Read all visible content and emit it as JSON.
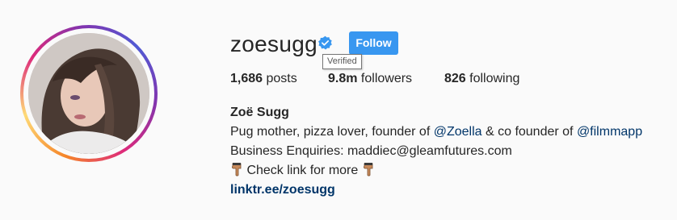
{
  "profile": {
    "username": "zoesugg",
    "verified": true,
    "follow_label": "Follow",
    "tooltip": "Verified",
    "stats": {
      "posts_count": "1,686",
      "posts_label": " posts",
      "followers_count": "9.8m",
      "followers_label": " followers",
      "following_count": "826",
      "following_label": " following"
    },
    "full_name": "Zoë Sugg",
    "bio": {
      "line1_a": "Pug mother, pizza lover, founder of ",
      "mention1": "@Zoella",
      "line1_b": " & co founder of ",
      "mention2": "@filmmapp",
      "line2": "Business Enquiries: maddiec@gleamfutures.com",
      "line3": " Check link for more ",
      "link": "linktr.ee/zoesugg"
    }
  },
  "colors": {
    "follow_button": "#3897f0",
    "verified_badge": "#3897f0",
    "link": "#003569",
    "text": "#262626",
    "background": "#fafafa"
  },
  "icons": {
    "verified": "verified-badge-icon",
    "hand": "backhand-index-pointing-down-emoji",
    "avatar": "profile-photo"
  }
}
